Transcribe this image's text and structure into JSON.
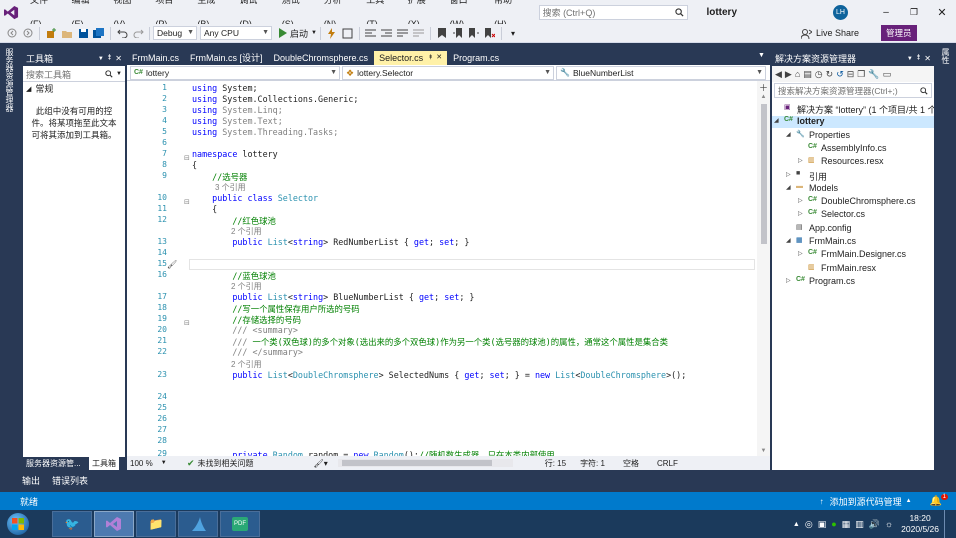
{
  "menu": {
    "items": [
      "文件(F)",
      "编辑(E)",
      "视图(V)",
      "项目(P)",
      "生成(B)",
      "调试(D)",
      "测试(S)",
      "分析(N)",
      "工具(T)",
      "扩展(X)",
      "窗口(W)",
      "帮助(H)"
    ]
  },
  "search": {
    "placeholder": "搜索 (Ctrl+Q)"
  },
  "solution_name": "lottery",
  "user_initials": "LH",
  "live_share": "Live Share",
  "admin_badge": "管理员",
  "toolbar": {
    "config": "Debug",
    "platform": "Any CPU",
    "start": "启动"
  },
  "left_vtab": "服务器资源管理器",
  "right_vtab": "属性",
  "toolbox": {
    "title": "工具箱",
    "search": "搜索工具箱",
    "section": "常规",
    "empty": "此组中没有可用的控件。将某项拖至此文本可将其添加到工具箱。",
    "footer_tabs": [
      "服务器资源管...",
      "工具箱"
    ]
  },
  "doc_tabs": [
    {
      "label": "FrmMain.cs"
    },
    {
      "label": "FrmMain.cs [设计]"
    },
    {
      "label": "DoubleChromsphere.cs"
    },
    {
      "label": "Selector.cs"
    },
    {
      "label": "Program.cs"
    }
  ],
  "nav": {
    "project": "lottery",
    "class": "lottery.Selector",
    "member": "BlueNumberList"
  },
  "code_lines": [
    {
      "n": "1",
      "html": "<span class='k'>using</span> System;"
    },
    {
      "n": "2",
      "html": "<span class='k'>using</span> System.Collections.Generic;"
    },
    {
      "n": "3",
      "html": "<span class='k'>using</span> <span class='g'>System.Linq;</span>"
    },
    {
      "n": "4",
      "html": "<span class='k'>using</span> <span class='g'>System.Text;</span>"
    },
    {
      "n": "5",
      "html": "<span class='k'>using</span> <span class='g'>System.Threading.Tasks;</span>"
    },
    {
      "n": "6",
      "html": ""
    },
    {
      "n": "7",
      "html": "<span class='k'>namespace</span> lottery"
    },
    {
      "n": "8",
      "html": "{"
    },
    {
      "n": "9",
      "html": "    <span class='c'>//选号器</span>"
    },
    {
      "n": "10",
      "html": "    <span class='k'>public class</span> <span class='t'>Selector</span>"
    },
    {
      "n": "11",
      "html": "    {"
    },
    {
      "n": "12",
      "html": "        <span class='c'>//红色球池</span>"
    },
    {
      "n": "13",
      "html": "        <span class='k'>public</span> <span class='t'>List</span>&lt;<span class='k'>string</span>&gt; RedNumberList { <span class='k'>get</span>; <span class='k'>set</span>; }"
    },
    {
      "n": "14",
      "html": ""
    },
    {
      "n": "15",
      "html": ""
    },
    {
      "n": "16",
      "html": "        <span class='c'>//蓝色球池</span>"
    },
    {
      "n": "17",
      "html": "        <span class='k'>public</span> <span class='t'>List</span>&lt;<span class='k'>string</span>&gt; BlueNumberList { <span class='k'>get</span>; <span class='k'>set</span>; }"
    },
    {
      "n": "18",
      "html": "        <span class='c'>//写一个属性保存用户所选的号码</span>"
    },
    {
      "n": "19",
      "html": "        <span class='c'>//存储选择的号码</span>"
    },
    {
      "n": "20",
      "html": "        <span class='g'>/// &lt;summary&gt;</span>"
    },
    {
      "n": "21",
      "html": "        <span class='g'>///</span> <span class='c'>一个类(双色球)的多个对象(选出来的多个双色球)作为另一个类(选号器的球池)的属性，通常这个属性是集合类</span>"
    },
    {
      "n": "22",
      "html": "        <span class='g'>/// &lt;/summary&gt;</span>"
    },
    {
      "n": "23",
      "html": "        <span class='k'>public</span> <span class='t'>List</span>&lt;<span class='t'>DoubleChromsphere</span>&gt; SelectedNums { <span class='k'>get</span>; <span class='k'>set</span>; } = <span class='k'>new</span> <span class='t'>List</span>&lt;<span class='t'>DoubleChromsphere</span>&gt;();"
    },
    {
      "n": "24",
      "html": ""
    },
    {
      "n": "25",
      "html": ""
    },
    {
      "n": "26",
      "html": ""
    },
    {
      "n": "27",
      "html": ""
    },
    {
      "n": "28",
      "html": ""
    },
    {
      "n": "29",
      "html": "        <span class='k'>private</span> <span class='t'>Random</span> random = <span class='k'>new</span> <span class='t'>Random</span>();<span class='c'>//随机数生成器，只在本类内部使用</span>"
    },
    {
      "n": "30",
      "html": ""
    }
  ],
  "refs": {
    "three": "3 个引用",
    "two": "2 个引用"
  },
  "editor_status": {
    "zoom": "100 %",
    "issues": "未找到相关问题",
    "line": "行: 15",
    "col": "字符: 1",
    "mode": "空格",
    "eol": "CRLF"
  },
  "solution_explorer": {
    "title": "解决方案资源管理器",
    "search": "搜索解决方案资源管理器(Ctrl+;)",
    "items": [
      {
        "label": "解决方案 “lottery” (1 个项目/共 1 个)"
      },
      {
        "label": "lottery"
      },
      {
        "label": "Properties"
      },
      {
        "label": "AssemblyInfo.cs"
      },
      {
        "label": "Resources.resx"
      },
      {
        "label": "引用"
      },
      {
        "label": "Models"
      },
      {
        "label": "DoubleChromsphere.cs"
      },
      {
        "label": "Selector.cs"
      },
      {
        "label": "App.config"
      },
      {
        "label": "FrmMain.cs"
      },
      {
        "label": "FrmMain.Designer.cs"
      },
      {
        "label": "FrmMain.resx"
      },
      {
        "label": "Program.cs"
      }
    ]
  },
  "bottom_tabs": [
    "输出",
    "错误列表"
  ],
  "status": {
    "ready": "就绪",
    "source_control": "添加到源代码管理",
    "notif": "1"
  },
  "taskbar": {
    "time": "18:20",
    "date": "2020/5/26",
    "pdf": "PDF"
  },
  "colors": {
    "accent": "#007acc",
    "tab_active": "#fff1a8",
    "chrome": "#293955"
  }
}
